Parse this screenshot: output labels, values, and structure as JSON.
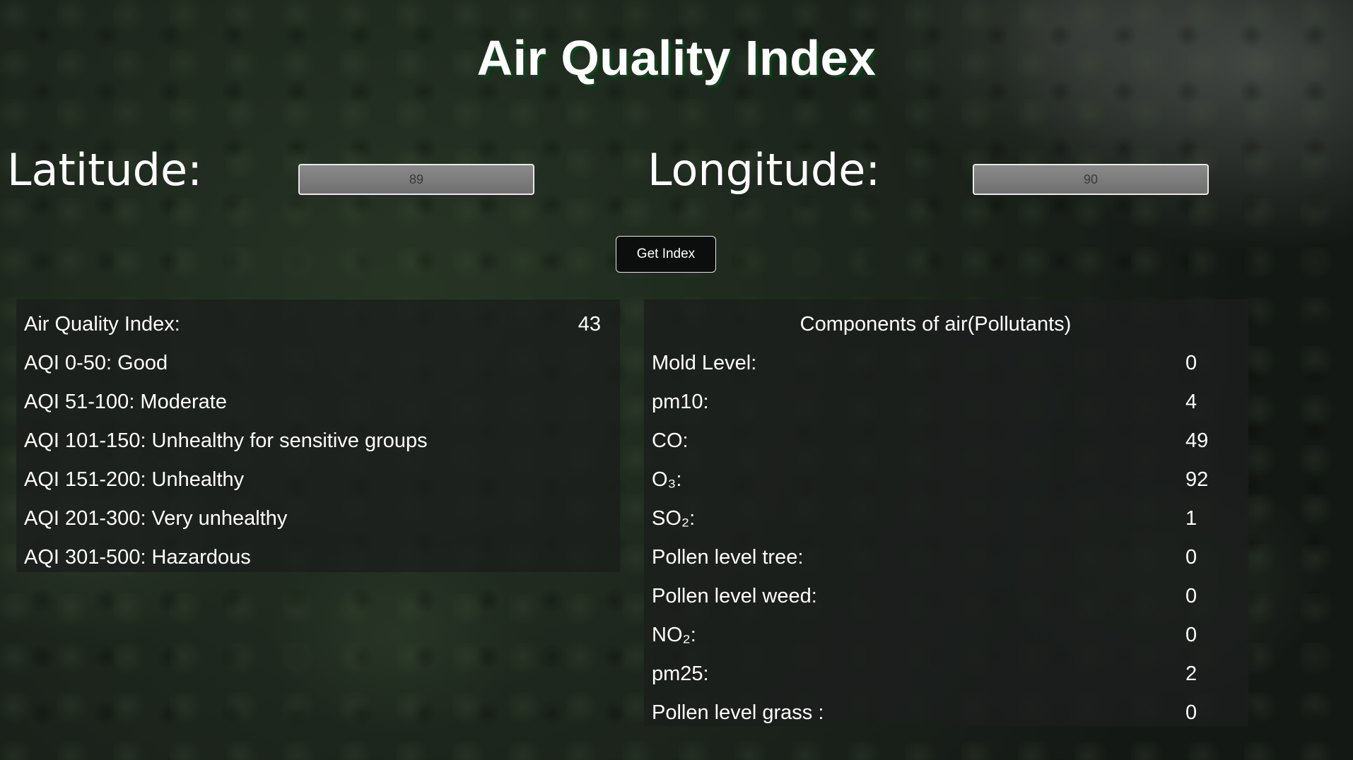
{
  "page": {
    "title": "Air Quality Index"
  },
  "inputs": {
    "latitude_label": "Latitude:",
    "latitude_value": "89",
    "longitude_label": "Longitude:",
    "longitude_value": "90"
  },
  "button": {
    "label": "Get Index"
  },
  "aqi_panel": {
    "index_label": "Air Quality Index:",
    "index_value": "43",
    "scale": [
      "AQI 0-50: Good",
      "AQI 51-100: Moderate",
      "AQI 101-150: Unhealthy for sensitive groups",
      "AQI 151-200: Unhealthy",
      "AQI 201-300: Very unhealthy",
      "AQI 301-500: Hazardous"
    ]
  },
  "components_panel": {
    "header": "Components of air(Pollutants)",
    "items": [
      {
        "label": "Mold Level:",
        "value": "0"
      },
      {
        "label": "pm10:",
        "value": "4"
      },
      {
        "label": "CO:",
        "value": "49"
      },
      {
        "label": "O₃:",
        "value": "92"
      },
      {
        "label": "SO₂:",
        "value": "1"
      },
      {
        "label": "Pollen level tree:",
        "value": "0"
      },
      {
        "label": "Pollen level weed:",
        "value": "0"
      },
      {
        "label": "NO₂:",
        "value": "0"
      },
      {
        "label": "pm25:",
        "value": "2"
      },
      {
        "label": "Pollen level grass :",
        "value": "0"
      }
    ]
  }
}
